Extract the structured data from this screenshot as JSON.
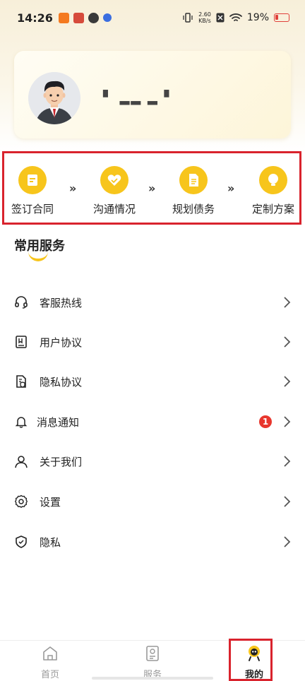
{
  "status_bar": {
    "time": "14:26",
    "net_speed_value": "2.60",
    "net_speed_unit": "KB/s",
    "battery": "19%"
  },
  "profile": {
    "username": "▘ ▂▂ ▂ ▘"
  },
  "steps": [
    {
      "label": "签订合同",
      "icon": "contract-icon"
    },
    {
      "label": "沟通情况",
      "icon": "heart-icon"
    },
    {
      "label": "规划债务",
      "icon": "document-icon"
    },
    {
      "label": "定制方案",
      "icon": "bulb-icon"
    }
  ],
  "section": {
    "title": "常用服务"
  },
  "menu": [
    {
      "label": "客服热线",
      "icon": "headset-icon"
    },
    {
      "label": "用户协议",
      "icon": "agreement-icon"
    },
    {
      "label": "隐私协议",
      "icon": "privacy-doc-icon"
    },
    {
      "label": "消息通知",
      "icon": "bell-icon",
      "badge": "1"
    },
    {
      "label": "关于我们",
      "icon": "user-icon"
    },
    {
      "label": "设置",
      "icon": "gear-icon"
    },
    {
      "label": "隐私",
      "icon": "shield-icon"
    }
  ],
  "bottom_nav": [
    {
      "label": "首页",
      "icon": "home-icon",
      "active": false
    },
    {
      "label": "服务",
      "icon": "service-icon",
      "active": false
    },
    {
      "label": "我的",
      "icon": "profile-mascot-icon",
      "active": true
    }
  ],
  "colors": {
    "accent_yellow": "#f7c51c",
    "highlight_red": "#d9232d",
    "badge_red": "#e8362d"
  }
}
